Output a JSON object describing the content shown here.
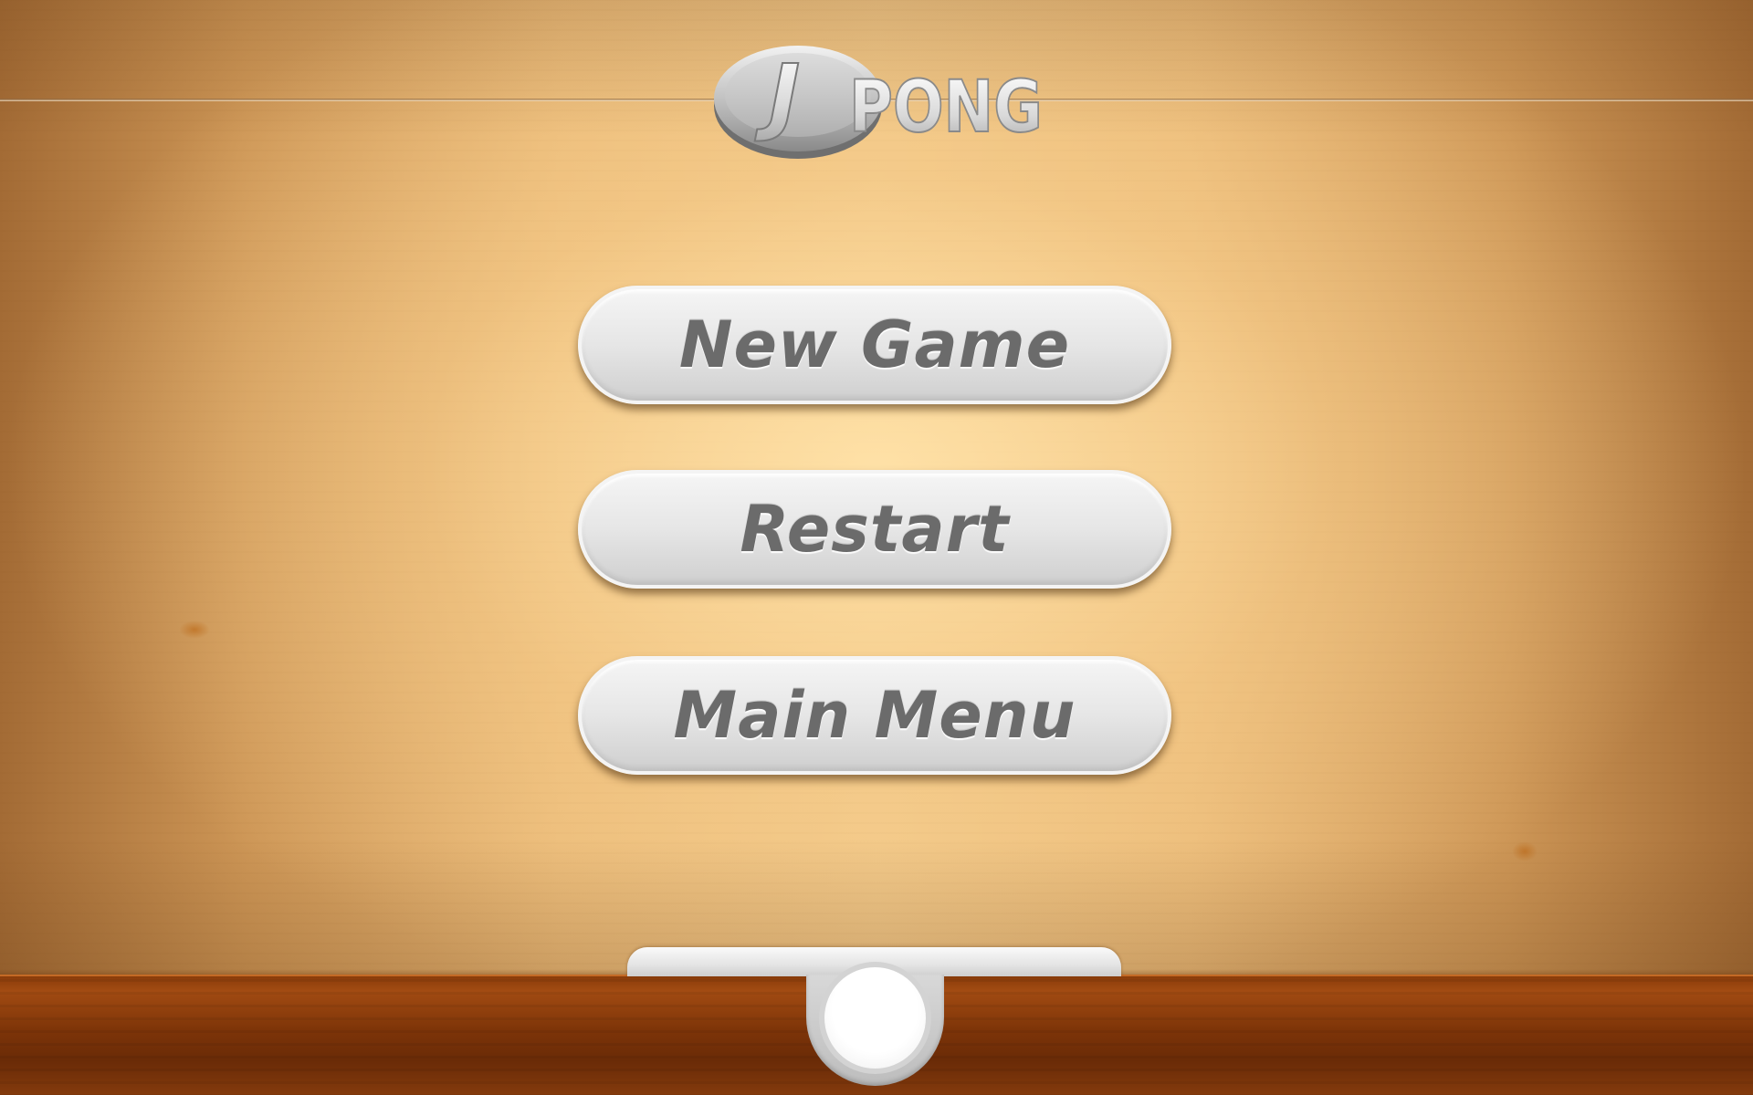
{
  "logo": {
    "letter": "J",
    "wordmark": "PONG"
  },
  "menu": {
    "new_game": "New Game",
    "restart": "Restart",
    "main_menu": "Main Menu"
  },
  "colors": {
    "table_wood_light": "#f2c98a",
    "table_wood_dark": "#a36b35",
    "floor_wood": "#7d3408",
    "button_face": "#e6e6e6",
    "button_text": "#6b6b6b"
  }
}
